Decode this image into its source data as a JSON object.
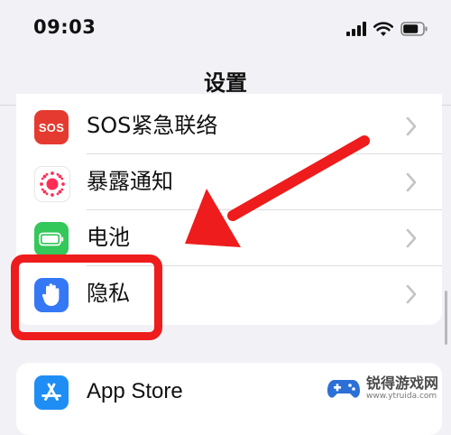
{
  "status_bar": {
    "time": "09:03"
  },
  "nav": {
    "title": "设置"
  },
  "settings": {
    "group1": [
      {
        "label": "SOS紧急联络",
        "icon_text": "SOS",
        "icon": "sos-icon",
        "icon_color": "#e53a2f"
      },
      {
        "label": "暴露通知",
        "icon": "exposure-notification-icon",
        "icon_color": "#ffffff",
        "accent": "#ff2d55"
      },
      {
        "label": "电池",
        "icon": "battery-icon",
        "icon_color": "#34c759"
      },
      {
        "label": "隐私",
        "icon": "privacy-hand-icon",
        "icon_color": "#3478f6"
      }
    ],
    "group2": [
      {
        "label": "App Store",
        "icon": "app-store-icon",
        "icon_color": "#1e8ef5"
      }
    ]
  },
  "annotation": {
    "color": "#ee1c1c"
  },
  "watermark": {
    "text": "锐得游戏网",
    "url": "www.ytruida.com"
  }
}
